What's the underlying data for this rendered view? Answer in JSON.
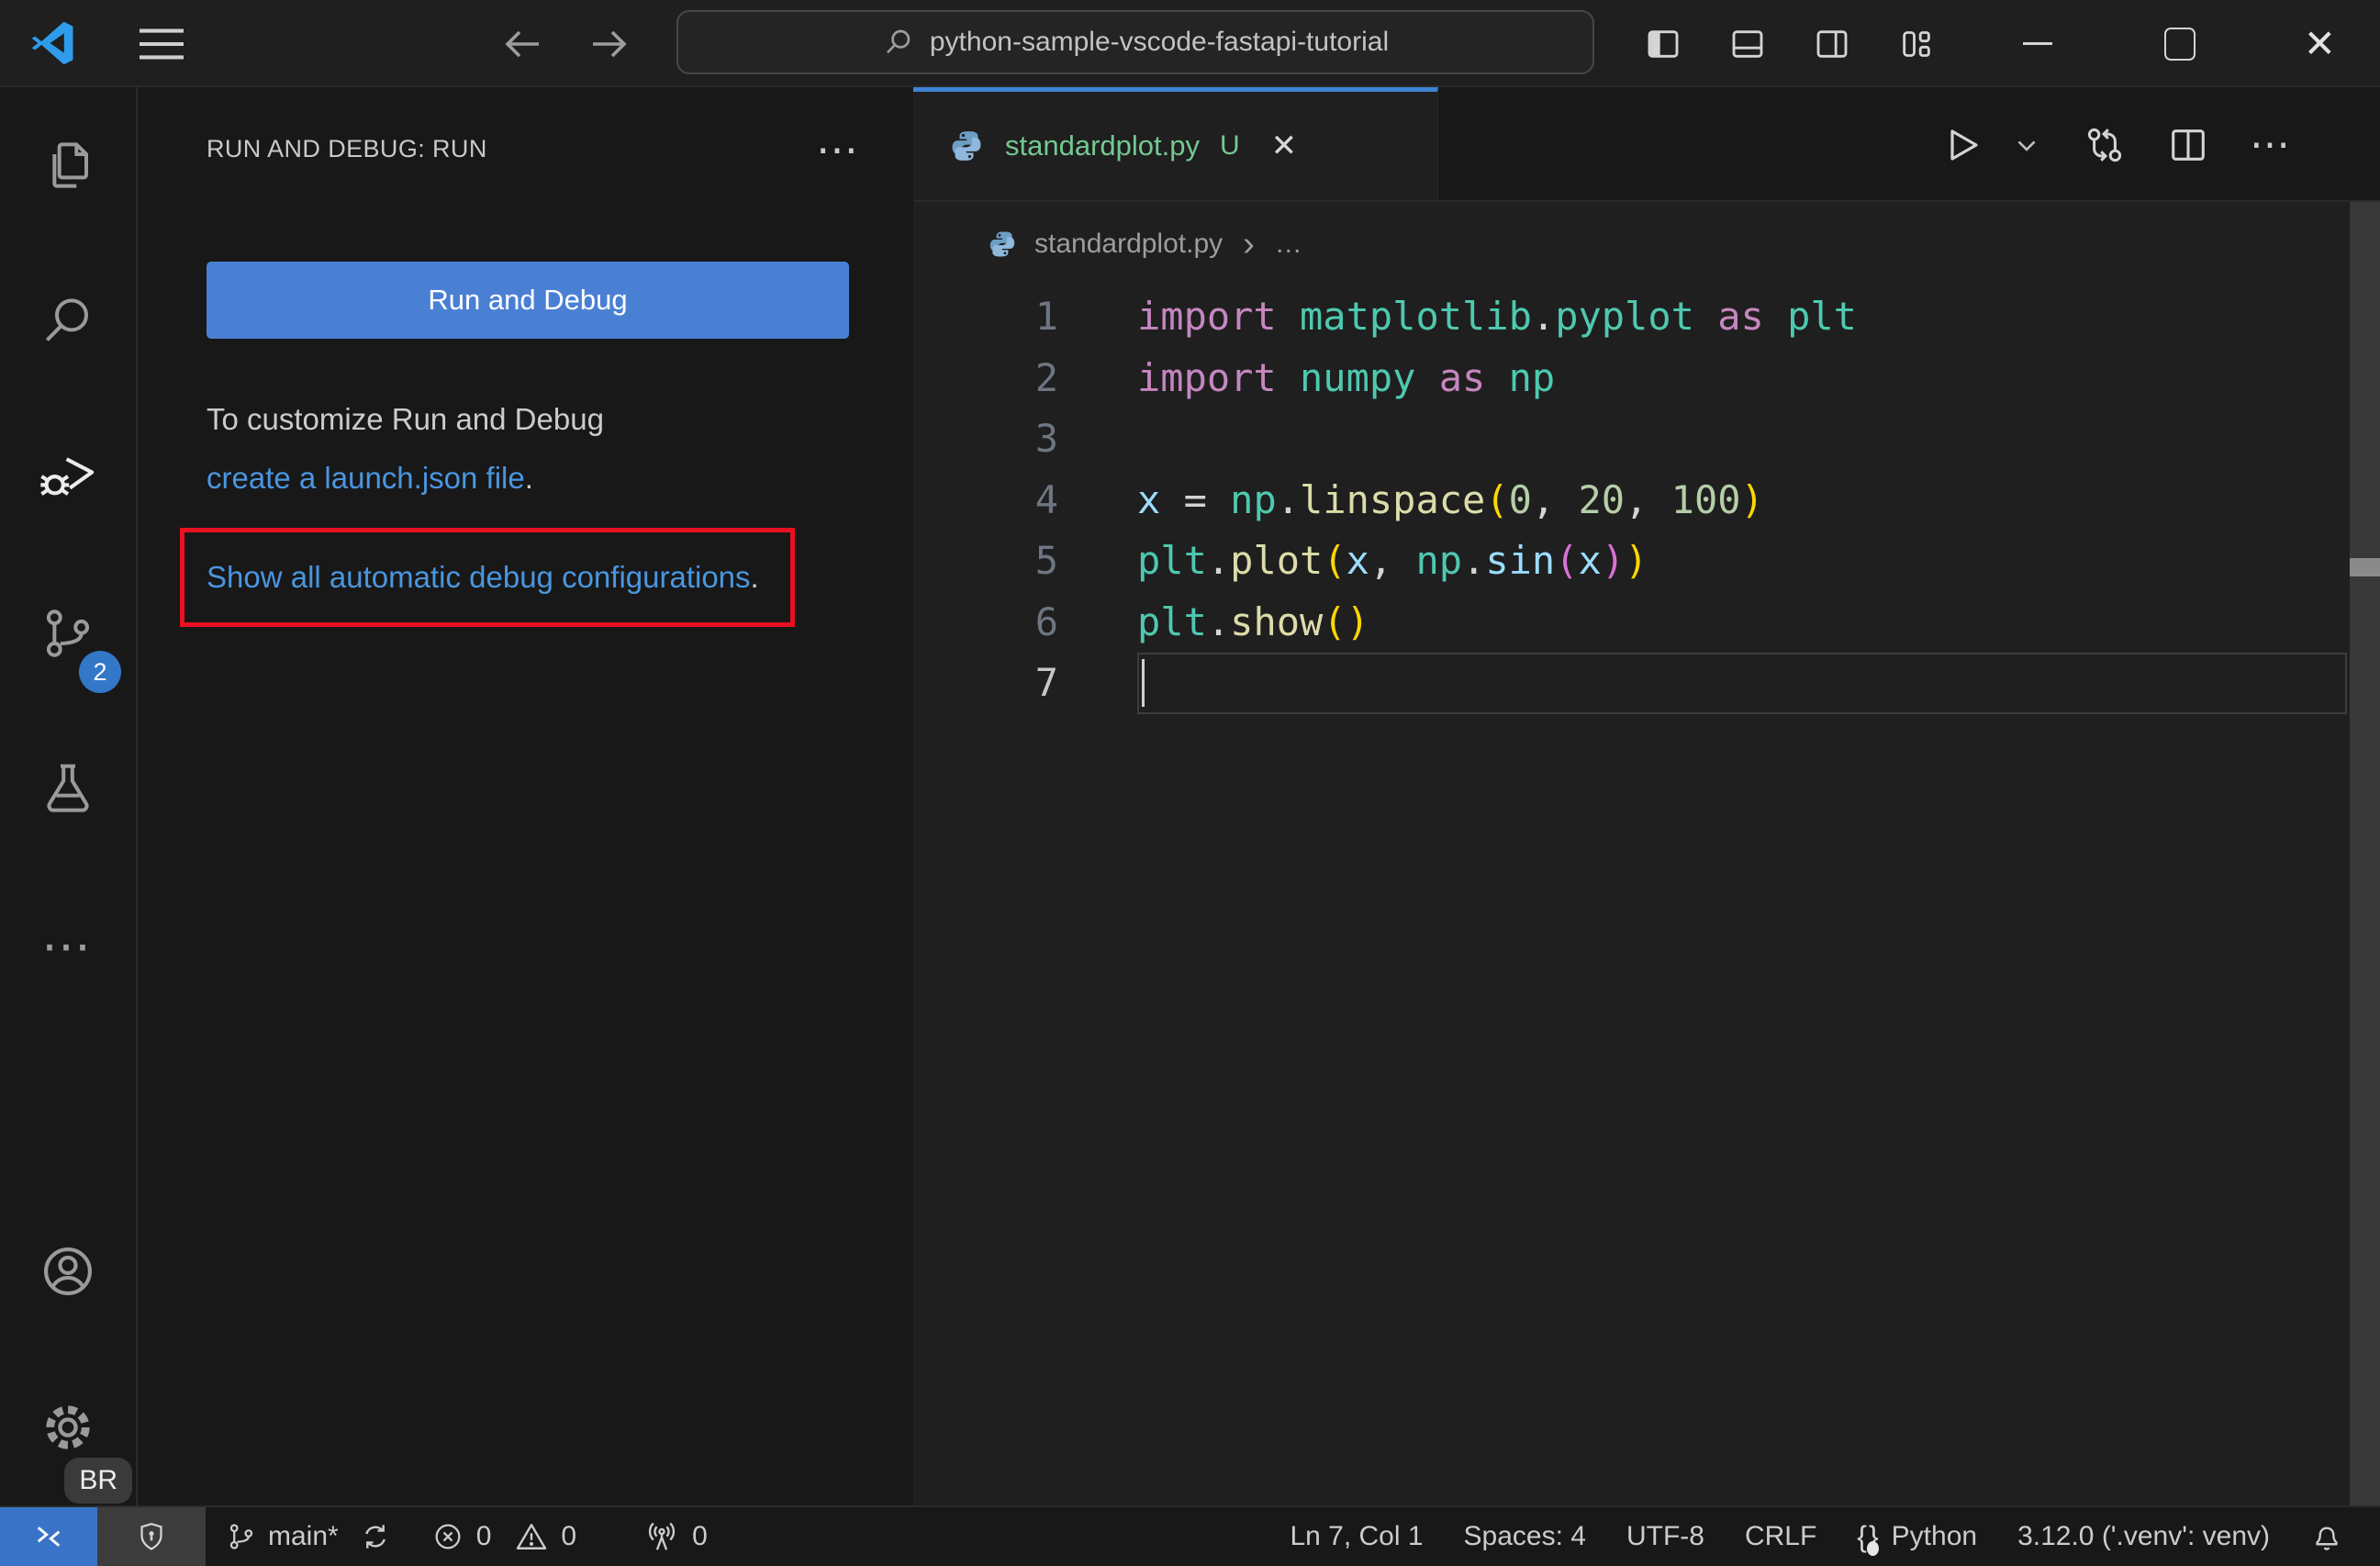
{
  "colors": {
    "accent_blue": "#3e82d6",
    "button_blue": "#4a80d4",
    "link_blue": "#4a96e0",
    "badge_blue": "#3277c8",
    "remote_blue": "#3a74c8",
    "git_untracked_green": "#73c991",
    "highlight_red": "#e81123",
    "code": {
      "keyword": "#c586c0",
      "module": "#4ec9b0",
      "function": "#dcdcaa",
      "variable": "#9cdcfe",
      "number": "#b5cea8",
      "punctuation": "#d4d4d4",
      "bracket1": "#ffd700",
      "bracket2": "#da70d6"
    }
  },
  "icons": {
    "close": "✕",
    "more_horizontal": "⋯",
    "breadcrumb_separator": "›",
    "brackets": "{}"
  },
  "title_bar": {
    "search_value": "python-sample-vscode-fastapi-tutorial"
  },
  "activity_bar": {
    "scm_badge": "2",
    "settings_badge": "BR"
  },
  "sidebar": {
    "title": "RUN AND DEBUG: RUN",
    "run_button": "Run and Debug",
    "customize_line1": "To customize Run and Debug",
    "customize_link": "create a launch.json file",
    "customize_suffix": ".",
    "auto_debug_link": "Show all automatic debug configurations",
    "auto_debug_suffix": "."
  },
  "editor": {
    "tab": {
      "label": "standardplot.py",
      "git_badge": "U"
    },
    "breadcrumb": {
      "file": "standardplot.py",
      "more": "…"
    },
    "code": {
      "current_line": 7,
      "line_numbers": [
        "1",
        "2",
        "3",
        "4",
        "5",
        "6",
        "7"
      ],
      "lines": [
        [
          [
            "import ",
            "keyword"
          ],
          [
            "matplotlib",
            "module"
          ],
          [
            ".",
            "punctuation"
          ],
          [
            "pyplot",
            "module"
          ],
          [
            " as ",
            "keyword"
          ],
          [
            "plt",
            "module"
          ]
        ],
        [
          [
            "import ",
            "keyword"
          ],
          [
            "numpy",
            "module"
          ],
          [
            " as ",
            "keyword"
          ],
          [
            "np",
            "module"
          ]
        ],
        [],
        [
          [
            "x",
            "variable"
          ],
          [
            " = ",
            "punctuation"
          ],
          [
            "np",
            "module"
          ],
          [
            ".",
            "punctuation"
          ],
          [
            "linspace",
            "function"
          ],
          [
            "(",
            "bracket1"
          ],
          [
            "0",
            "number"
          ],
          [
            ", ",
            "punctuation"
          ],
          [
            "20",
            "number"
          ],
          [
            ", ",
            "punctuation"
          ],
          [
            "100",
            "number"
          ],
          [
            ")",
            "bracket1"
          ]
        ],
        [
          [
            "plt",
            "module"
          ],
          [
            ".",
            "punctuation"
          ],
          [
            "plot",
            "function"
          ],
          [
            "(",
            "bracket1"
          ],
          [
            "x",
            "variable"
          ],
          [
            ", ",
            "punctuation"
          ],
          [
            "np",
            "module"
          ],
          [
            ".",
            "punctuation"
          ],
          [
            "sin",
            "variable"
          ],
          [
            "(",
            "bracket2"
          ],
          [
            "x",
            "variable"
          ],
          [
            ")",
            "bracket2"
          ],
          [
            ")",
            "bracket1"
          ]
        ],
        [
          [
            "plt",
            "module"
          ],
          [
            ".",
            "punctuation"
          ],
          [
            "show",
            "function"
          ],
          [
            "(",
            "bracket1"
          ],
          [
            ")",
            "bracket1"
          ]
        ],
        []
      ]
    }
  },
  "status_bar": {
    "branch": "main*",
    "errors": "0",
    "warnings": "0",
    "ports": "0",
    "cursor_position": "Ln 7, Col 1",
    "indentation": "Spaces: 4",
    "encoding": "UTF-8",
    "eol": "CRLF",
    "language": "Python",
    "interpreter": "3.12.0 ('.venv': venv)"
  }
}
